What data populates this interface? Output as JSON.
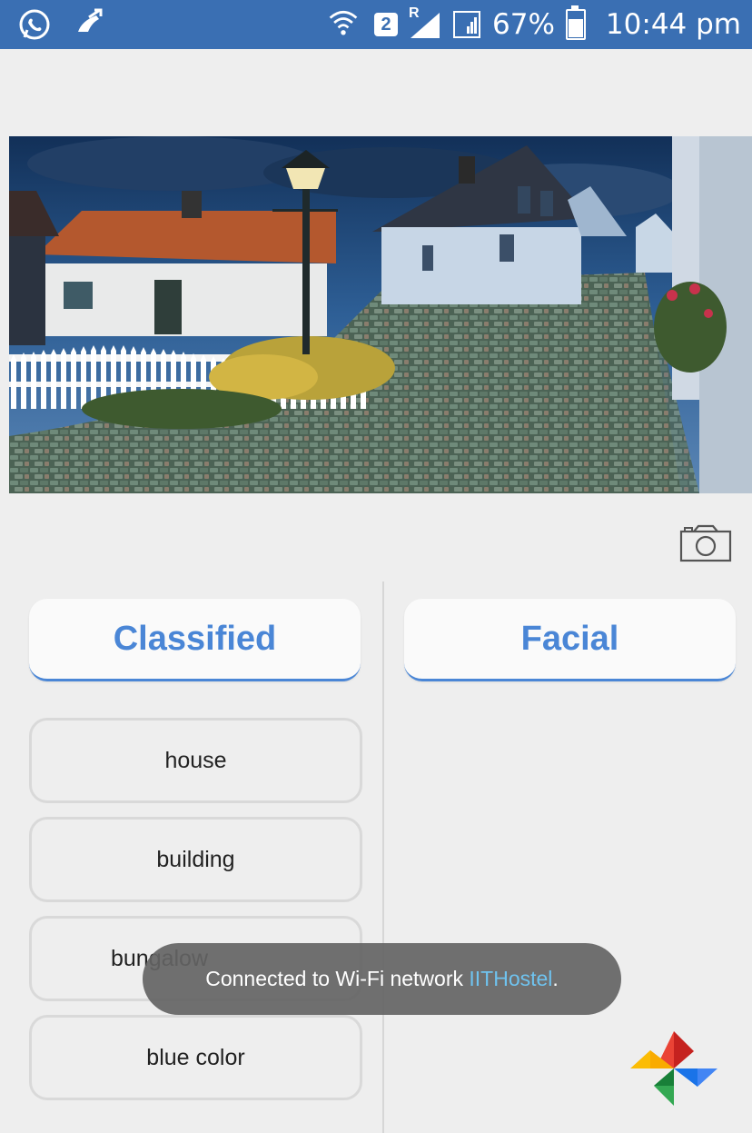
{
  "status_bar": {
    "left_icons": [
      "whatsapp-icon",
      "missed-call-icon"
    ],
    "sim_number": "2",
    "roaming_label": "R",
    "battery": "67%",
    "battery_level": 0.67,
    "time": "10:44 pm"
  },
  "photo": {
    "subject": "house-street-photo"
  },
  "camera_button": {
    "icon": "camera-icon"
  },
  "columns": {
    "left_title": "Classified",
    "right_title": "Facial"
  },
  "results": [
    {
      "label": "house"
    },
    {
      "label": "building"
    },
    {
      "label": "bungalow"
    },
    {
      "label": "blue color"
    }
  ],
  "toast": {
    "prefix": "Connected to Wi-Fi network ",
    "network": "IITHostel",
    "suffix": "."
  },
  "colors": {
    "status_bar": "#3a6fb3",
    "accent": "#4a86d6",
    "toast_bg": "#646464",
    "link": "#6fc3ef"
  },
  "app_logo": {
    "icon": "google-photos-icon"
  }
}
